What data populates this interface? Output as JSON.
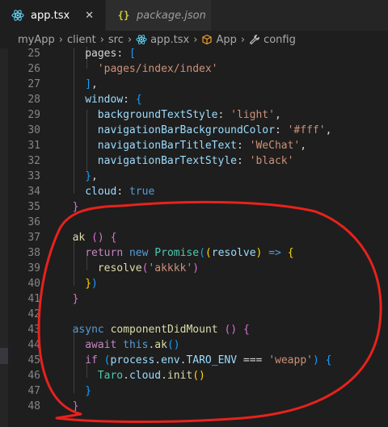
{
  "tabs": [
    {
      "label": "app.tsx",
      "icon": "react-icon",
      "close": "✕",
      "active": true
    },
    {
      "label": "package.json",
      "icon": "json-icon",
      "icon_text": "{}",
      "active": false
    }
  ],
  "breadcrumb": [
    "myApp",
    "client",
    "src",
    "app.tsx",
    "App",
    "config"
  ],
  "breadcrumb_sep": "›",
  "line_numbers": [
    "25",
    "26",
    "27",
    "28",
    "29",
    "30",
    "31",
    "32",
    "33",
    "34",
    "35",
    "36",
    "37",
    "38",
    "39",
    "40",
    "41",
    "42",
    "43",
    "44",
    "45",
    "46",
    "47",
    "48"
  ],
  "code_lines": [
    [
      [
        "d",
        "pages: "
      ],
      [
        "b3",
        "["
      ]
    ],
    [
      [
        "s",
        "'pages/index/index'"
      ]
    ],
    [
      [
        "b3",
        "]"
      ],
      [
        "d",
        ","
      ]
    ],
    [
      [
        "p",
        "window"
      ],
      [
        "d",
        ": "
      ],
      [
        "b3",
        "{"
      ]
    ],
    [
      [
        "p",
        "backgroundTextStyle"
      ],
      [
        "d",
        ": "
      ],
      [
        "s",
        "'light'"
      ],
      [
        "d",
        ","
      ]
    ],
    [
      [
        "p",
        "navigationBarBackgroundColor"
      ],
      [
        "d",
        ": "
      ],
      [
        "s",
        "'#fff'"
      ],
      [
        "d",
        ","
      ]
    ],
    [
      [
        "p",
        "navigationBarTitleText"
      ],
      [
        "d",
        ": "
      ],
      [
        "s",
        "'WeChat'"
      ],
      [
        "d",
        ","
      ]
    ],
    [
      [
        "p",
        "navigationBarTextStyle"
      ],
      [
        "d",
        ": "
      ],
      [
        "s",
        "'black'"
      ]
    ],
    [
      [
        "b3",
        "}"
      ],
      [
        "d",
        ","
      ]
    ],
    [
      [
        "p",
        "cloud"
      ],
      [
        "d",
        ": "
      ],
      [
        "k",
        "true"
      ]
    ],
    [
      [
        "b2",
        "}"
      ]
    ],
    [],
    [
      [
        "f",
        "ak"
      ],
      [
        "d",
        " "
      ],
      [
        "b2",
        "()"
      ],
      [
        "d",
        " "
      ],
      [
        "b2",
        "{"
      ]
    ],
    [
      [
        "c",
        "return"
      ],
      [
        "d",
        " "
      ],
      [
        "k",
        "new"
      ],
      [
        "d",
        " "
      ],
      [
        "t",
        "Promise"
      ],
      [
        "b3",
        "("
      ],
      [
        "b1",
        "("
      ],
      [
        "p",
        "resolve"
      ],
      [
        "b1",
        ")"
      ],
      [
        "d",
        " "
      ],
      [
        "k",
        "=>"
      ],
      [
        "d",
        " "
      ],
      [
        "b1",
        "{"
      ]
    ],
    [
      [
        "f",
        "resolve"
      ],
      [
        "b2",
        "("
      ],
      [
        "s",
        "'akkkk'"
      ],
      [
        "b2",
        ")"
      ]
    ],
    [
      [
        "b1",
        "}"
      ],
      [
        "b3",
        ")"
      ]
    ],
    [
      [
        "b2",
        "}"
      ]
    ],
    [],
    [
      [
        "k",
        "async"
      ],
      [
        "d",
        " "
      ],
      [
        "f",
        "componentDidMount"
      ],
      [
        "d",
        " "
      ],
      [
        "b2",
        "()"
      ],
      [
        "d",
        " "
      ],
      [
        "b2",
        "{"
      ]
    ],
    [
      [
        "c",
        "await"
      ],
      [
        "d",
        " "
      ],
      [
        "k",
        "this"
      ],
      [
        "d",
        "."
      ],
      [
        "f",
        "ak"
      ],
      [
        "b3",
        "()"
      ]
    ],
    [
      [
        "c",
        "if"
      ],
      [
        "d",
        " "
      ],
      [
        "b3",
        "("
      ],
      [
        "p",
        "process"
      ],
      [
        "d",
        "."
      ],
      [
        "p",
        "env"
      ],
      [
        "d",
        "."
      ],
      [
        "p",
        "TARO_ENV"
      ],
      [
        "d",
        " === "
      ],
      [
        "s",
        "'weapp'"
      ],
      [
        "b3",
        ")"
      ],
      [
        "d",
        " "
      ],
      [
        "b3",
        "{"
      ]
    ],
    [
      [
        "t",
        "Taro"
      ],
      [
        "d",
        "."
      ],
      [
        "p",
        "cloud"
      ],
      [
        "d",
        "."
      ],
      [
        "f",
        "init"
      ],
      [
        "b1",
        "()"
      ]
    ],
    [
      [
        "b3",
        "}"
      ]
    ],
    [
      [
        "b2",
        "}"
      ]
    ]
  ],
  "annotation_color": "#e8221c"
}
